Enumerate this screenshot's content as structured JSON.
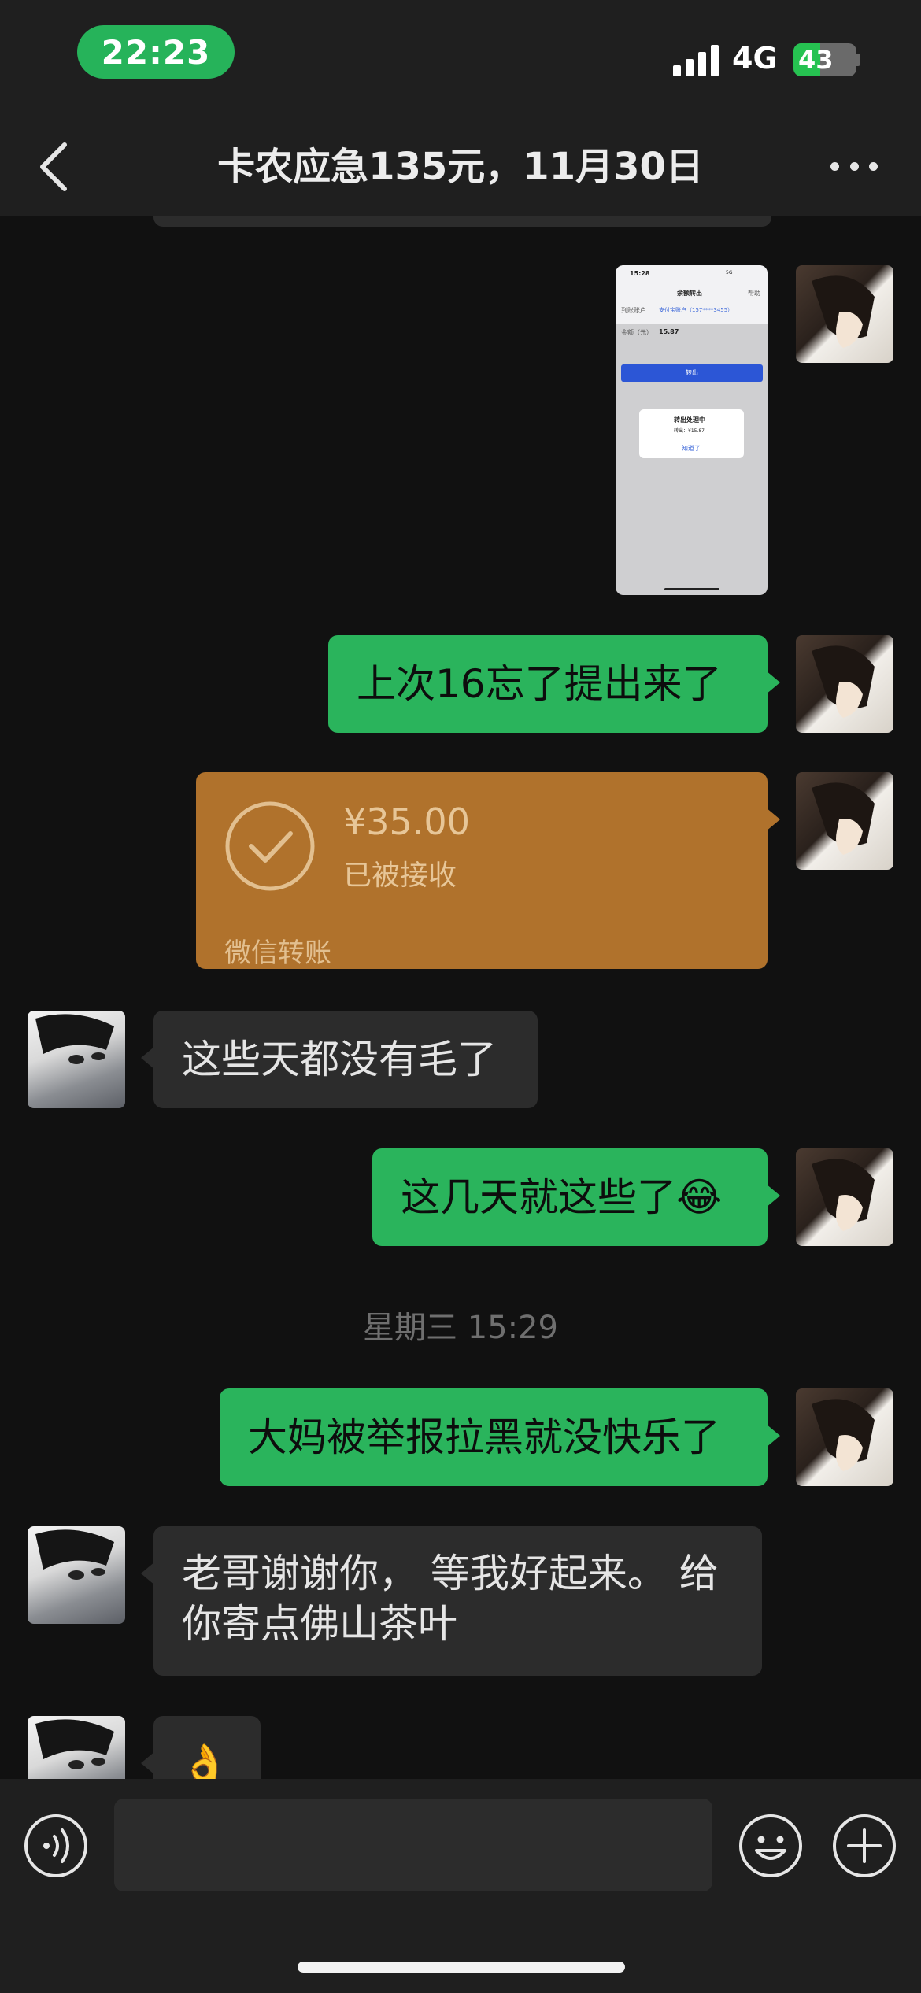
{
  "status_bar": {
    "time": "22:23",
    "network": "4G",
    "battery": "43",
    "battery_level": 0.43
  },
  "header": {
    "title": "卡农应急135元，11月30日",
    "back_icon": "chevron-left-icon",
    "more_icon": "more-dots-icon"
  },
  "messages": [
    {
      "id": "m1",
      "sender": "me",
      "type": "image",
      "image": {
        "time": "15:28",
        "network": "5G",
        "page_title": "余额转出",
        "help": "帮助",
        "to_label": "到账账户",
        "to_value": "支付宝账户（157****3455）",
        "amount_label": "金额（元）",
        "amount_value": "15.87",
        "submit": "转出",
        "dialog_title": "转出处理中",
        "dialog_amount": "转出：¥15.87",
        "dialog_ok": "知道了"
      }
    },
    {
      "id": "m2",
      "sender": "me",
      "type": "text",
      "text": "上次16忘了提出来了"
    },
    {
      "id": "m3",
      "sender": "me",
      "type": "transfer",
      "amount": "¥35.00",
      "status": "已被接收",
      "label": "微信转账"
    },
    {
      "id": "m4",
      "sender": "other",
      "type": "text",
      "text": "这些天都没有毛了"
    },
    {
      "id": "m5",
      "sender": "me",
      "type": "text",
      "text": "这几天就这些了😂"
    },
    {
      "id": "m6",
      "sender": "me",
      "type": "text",
      "text": "大妈被举报拉黑就没快乐了"
    },
    {
      "id": "m7",
      "sender": "other",
      "type": "text",
      "text": "老哥谢谢你， 等我好起来。 给你寄点佛山茶叶"
    },
    {
      "id": "m8",
      "sender": "other",
      "type": "text",
      "text": "👌"
    }
  ],
  "timestamp": "星期三 15:29",
  "input_bar": {
    "placeholder": "",
    "voice_icon": "voice-icon",
    "emoji_icon": "emoji-icon",
    "plus_icon": "plus-icon"
  },
  "colors": {
    "my_bubble": "#2ab45c",
    "other_bubble": "#2c2c2c",
    "transfer": "#b0722c",
    "background": "#111111",
    "bar": "#1f1f1f"
  }
}
